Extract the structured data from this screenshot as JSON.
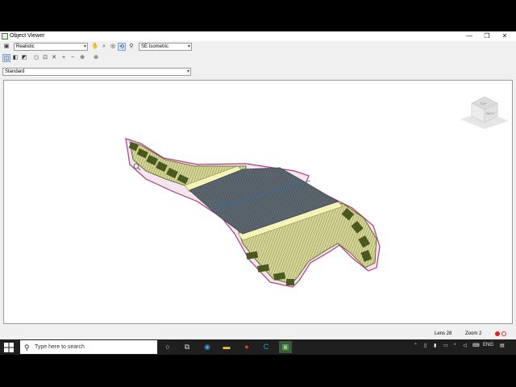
{
  "window": {
    "title": "Object Viewer",
    "minimize": "—",
    "restore": "❐",
    "close": "✕"
  },
  "toolbar": {
    "visual_style": "Realistic",
    "view": "SE Isometric",
    "named_style": "Standard"
  },
  "viewcube": {
    "top_label": "TOP",
    "front_label": "BACK"
  },
  "status": {
    "lens": "Lens 28",
    "zoom": "Zoom 2"
  },
  "taskbar": {
    "search_placeholder": "Type here to search",
    "language": "ENG"
  },
  "colors": {
    "hatch": "#c8c88a",
    "slope": "#4a5a1e",
    "pad": "#556069",
    "boundary": "#b03a7a",
    "accent": "#2f6fb7"
  }
}
